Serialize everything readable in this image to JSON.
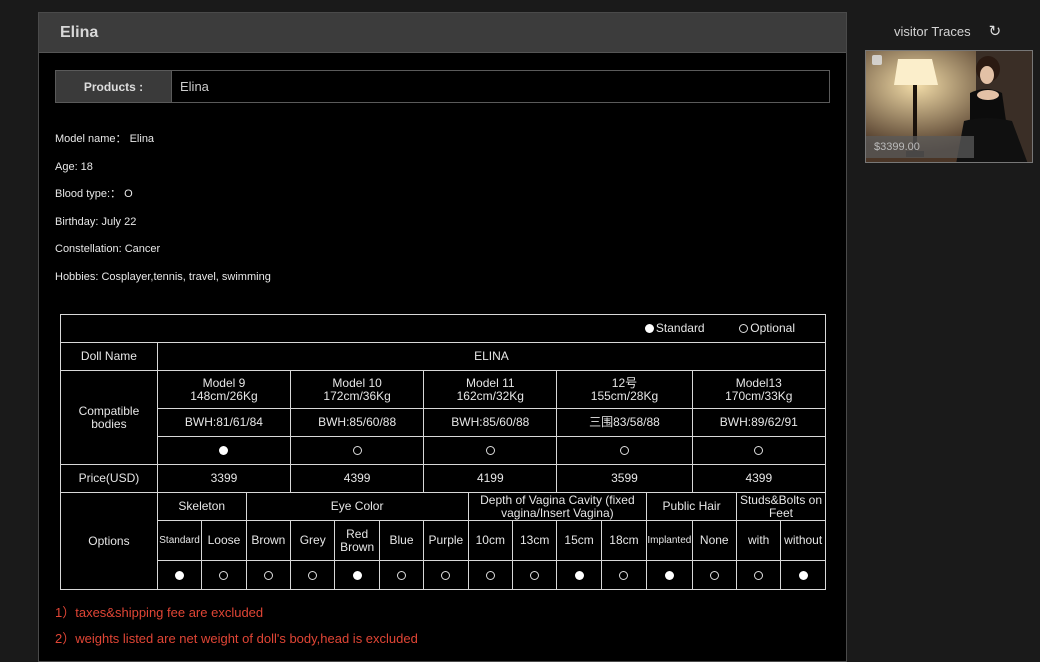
{
  "panel": {
    "title": "Elina"
  },
  "product": {
    "label": "Products :",
    "value": "Elina"
  },
  "info": [
    "Model name： Elina",
    "Age: 18",
    "Blood type:：  O",
    "Birthday: July 22",
    "Constellation: Cancer",
    "Hobbies:  Cosplayer,tennis, travel, swimming"
  ],
  "table": {
    "legend": {
      "standard": "Standard",
      "optional": "Optional"
    },
    "doll_name_label": "Doll Name",
    "doll_name_value": "ELINA",
    "compatible_label": "Compatible bodies",
    "models": [
      {
        "name": "Model 9",
        "size": "148cm/26Kg",
        "bwh": "BWH:81/61/84",
        "selected": true,
        "price": "3399"
      },
      {
        "name": "Model 10",
        "size": "172cm/36Kg",
        "bwh": "BWH:85/60/88",
        "selected": false,
        "price": "4399"
      },
      {
        "name": "Model 11",
        "size": "162cm/32Kg",
        "bwh": "BWH:85/60/88",
        "selected": false,
        "price": "4199"
      },
      {
        "name": "12号",
        "size": "155cm/28Kg",
        "bwh": "三围83/58/88",
        "selected": false,
        "price": "3599"
      },
      {
        "name": "Model13",
        "size": "170cm/33Kg",
        "bwh": "BWH:89/62/91",
        "selected": false,
        "price": "4399"
      }
    ],
    "price_label": "Price(USD)",
    "options_label": "Options",
    "option_groups": [
      {
        "name": "Skeleton",
        "values": [
          "Standard",
          "Loose"
        ]
      },
      {
        "name": "Eye Color",
        "values": [
          "Brown",
          "Grey",
          "Red Brown",
          "Blue",
          "Purple"
        ]
      },
      {
        "name": "Depth of Vagina Cavity (fixed vagina/Insert Vagina)",
        "values": [
          "10cm",
          "13cm",
          "15cm",
          "18cm"
        ]
      },
      {
        "name": "Public Hair",
        "values": [
          "Implanted",
          "None"
        ]
      },
      {
        "name": "Studs&Bolts on Feet",
        "values": [
          "with",
          "without"
        ]
      }
    ],
    "option_selected": [
      true,
      false,
      false,
      false,
      true,
      false,
      false,
      false,
      false,
      true,
      false,
      true,
      false,
      false,
      true
    ]
  },
  "notes": [
    "1）taxes&shipping fee are excluded",
    "2）weights listed are net weight of doll's body,head is excluded"
  ],
  "visitor": {
    "title": "visitor Traces",
    "refresh_icon": "refresh-icon"
  },
  "thumbnail": {
    "price": "$3399.00"
  },
  "colors": {
    "accent_red": "#e04535",
    "panel_header": "#3c3c3c"
  }
}
